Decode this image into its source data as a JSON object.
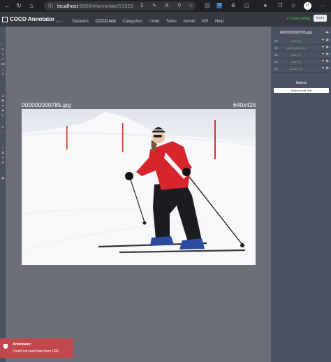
{
  "browser": {
    "url_host": "localhost",
    "url_path": ":5000/#/annotate/51529",
    "profile_letter": "U"
  },
  "app": {
    "brand": "COCO Annotator",
    "version": "v0.11.1",
    "nav": [
      "Datasets",
      "COCO test",
      "Categories",
      "Undo",
      "Tasks",
      "Admin",
      "API",
      "Help"
    ],
    "status": "✔ Done saving",
    "user": "fred ▾"
  },
  "sidebar": {
    "file_name": "000000000785.jpg",
    "categories": [
      {
        "label": "chair (0)"
      },
      {
        "label": "potted plant (0)"
      },
      {
        "label": "vase (0)"
      },
      {
        "label": "cake (0)"
      },
      {
        "label": "person (0)"
      }
    ],
    "select_title": "Select",
    "hover_button": "Show Hover Text"
  },
  "image": {
    "name": "000000000785.jpg",
    "dimensions": "640x425"
  },
  "toast": {
    "title": "Annotator",
    "message": "Could not read data from URL"
  },
  "colors": {
    "appbar": "#343a40",
    "canvas": "#6b6f7a",
    "panel": "#4b5160",
    "toast": "#c0484c",
    "done": "#5ecb5e"
  }
}
